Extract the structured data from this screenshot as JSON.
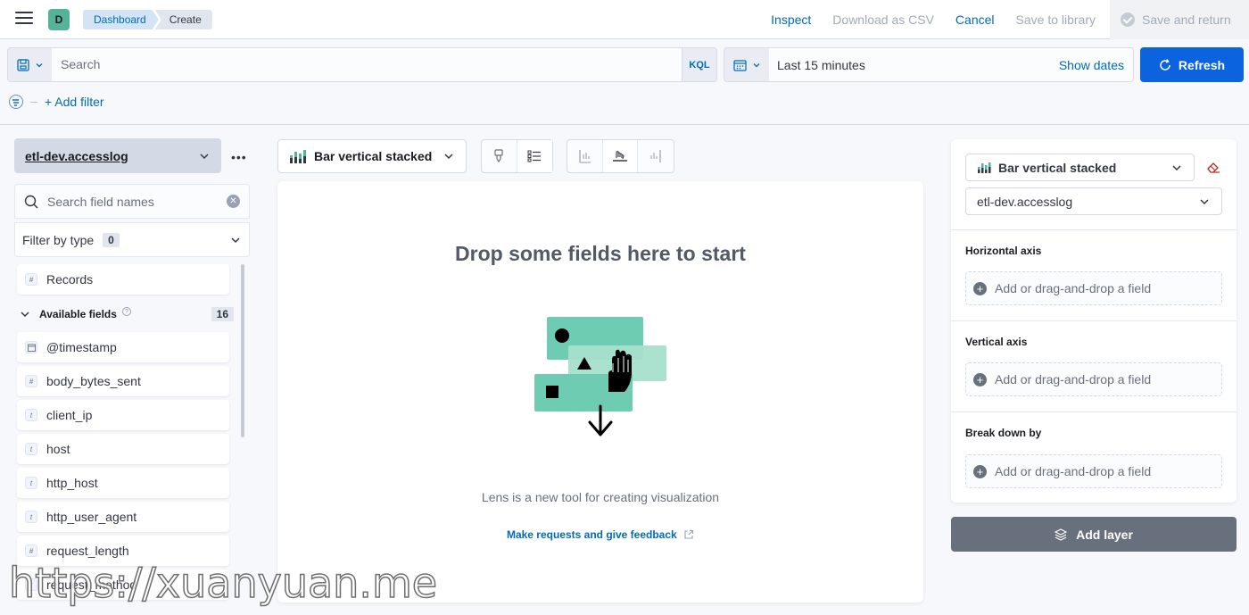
{
  "header": {
    "space_initial": "D",
    "breadcrumbs": [
      "Dashboard",
      "Create"
    ],
    "actions": {
      "inspect": "Inspect",
      "download_csv": "Download as CSV",
      "cancel": "Cancel",
      "save_to_library": "Save to library",
      "save_and_return": "Save and return"
    }
  },
  "query_bar": {
    "search_placeholder": "Search",
    "language": "KQL",
    "time_range": "Last 15 minutes",
    "show_dates": "Show dates",
    "refresh": "Refresh",
    "add_filter": "+ Add filter"
  },
  "sidebar": {
    "index_pattern": "etl-dev.accesslog",
    "field_search_placeholder": "Search field names",
    "filter_by_type": "Filter by type",
    "filter_count": "0",
    "records": {
      "type": "#",
      "name": "Records"
    },
    "available_label": "Available fields",
    "available_count": "16",
    "fields": [
      {
        "type": "date",
        "name": "@timestamp"
      },
      {
        "type": "#",
        "name": "body_bytes_sent"
      },
      {
        "type": "t",
        "name": "client_ip"
      },
      {
        "type": "t",
        "name": "host"
      },
      {
        "type": "t",
        "name": "http_host"
      },
      {
        "type": "t",
        "name": "http_user_agent"
      },
      {
        "type": "#",
        "name": "request_length"
      },
      {
        "type": "t",
        "name": "request_method"
      }
    ]
  },
  "toolbar": {
    "chart_type": "Bar vertical stacked"
  },
  "workspace": {
    "drop_title": "Drop some fields here to start",
    "lens_text": "Lens is a new tool for creating visualization",
    "feedback_link": "Make requests and give feedback"
  },
  "config": {
    "chart_type": "Bar vertical stacked",
    "index_pattern": "etl-dev.accesslog",
    "sections": [
      {
        "title": "Horizontal axis",
        "placeholder": "Add or drag-and-drop a field"
      },
      {
        "title": "Vertical axis",
        "placeholder": "Add or drag-and-drop a field"
      },
      {
        "title": "Break down by",
        "placeholder": "Add or drag-and-drop a field"
      }
    ],
    "add_layer": "Add layer"
  },
  "watermark": "https://xuanyuan.me"
}
